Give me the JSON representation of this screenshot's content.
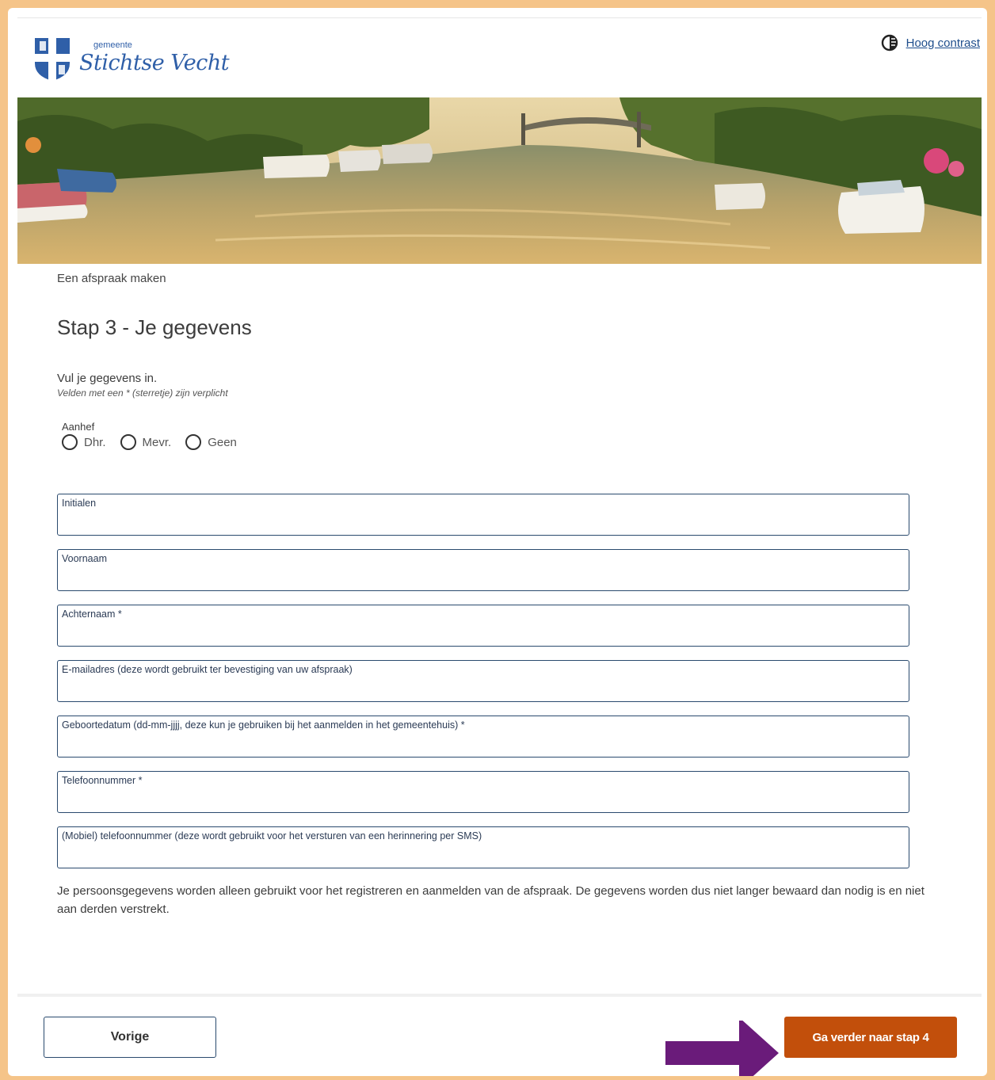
{
  "header": {
    "logo_small": "gemeente",
    "logo_name": "Stichtse Vecht",
    "contrast_link": "Hoog contrast"
  },
  "breadcrumb": "Een afspraak maken",
  "title": "Stap 3 - Je gegevens",
  "intro": "Vul je gegevens in.",
  "required_note": "Velden met een * (sterretje) zijn verplicht",
  "aanhef": {
    "label": "Aanhef",
    "options": [
      "Dhr.",
      "Mevr.",
      "Geen"
    ]
  },
  "fields": [
    {
      "label": "Initialen",
      "value": ""
    },
    {
      "label": "Voornaam",
      "value": ""
    },
    {
      "label": "Achternaam *",
      "value": ""
    },
    {
      "label": "E-mailadres (deze wordt gebruikt ter bevestiging van uw afspraak)",
      "value": ""
    },
    {
      "label": "Geboortedatum (dd-mm-jjjj, deze kun je gebruiken bij het aanmelden in het gemeentehuis) *",
      "value": ""
    },
    {
      "label": "Telefoonnummer *",
      "value": ""
    },
    {
      "label": "(Mobiel) telefoonnummer (deze wordt gebruikt voor het versturen van een herinnering per SMS)",
      "value": ""
    }
  ],
  "privacy_text": "Je persoonsgegevens worden alleen gebruikt voor het registreren en aanmelden van de afspraak. De gegevens worden dus niet langer bewaard dan nodig is en niet aan derden verstrekt.",
  "buttons": {
    "prev": "Vorige",
    "next": "Ga verder naar stap 4"
  },
  "colors": {
    "frame": "#f5c489",
    "brand_blue": "#2f5fa8",
    "next_button": "#c24f0b",
    "arrow": "#6a1b7a"
  },
  "icons": {
    "contrast": "contrast-icon",
    "logo": "shield-cross-icon",
    "annotation_arrow": "arrow-right-icon"
  }
}
